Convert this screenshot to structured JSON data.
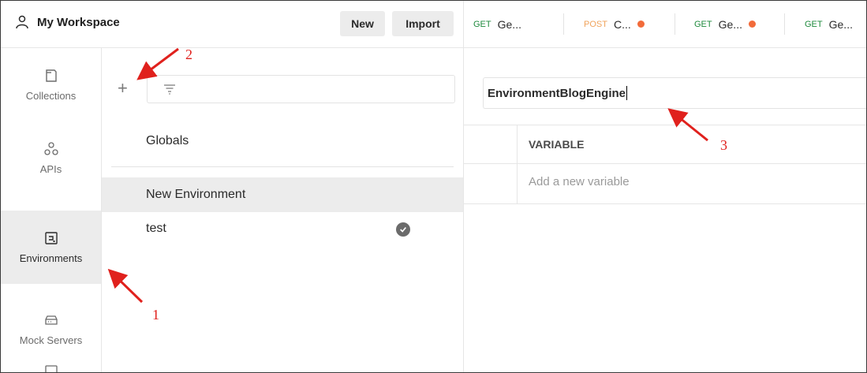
{
  "header": {
    "workspace_title": "My Workspace",
    "new_label": "New",
    "import_label": "Import"
  },
  "sidebar": {
    "items": [
      {
        "label": "Collections",
        "icon": "collections-icon"
      },
      {
        "label": "APIs",
        "icon": "apis-icon"
      },
      {
        "label": "Environments",
        "icon": "environments-icon",
        "active": true
      },
      {
        "label": "Mock Servers",
        "icon": "mock-servers-icon"
      }
    ]
  },
  "env_list": {
    "items": [
      {
        "label": "Globals"
      },
      {
        "label": "New Environment",
        "selected": true
      },
      {
        "label": "test",
        "active_check": true
      }
    ]
  },
  "tabs": [
    {
      "method": "GET",
      "title": "Ge...",
      "unsaved": false
    },
    {
      "method": "POST",
      "title": "C...",
      "unsaved": true
    },
    {
      "method": "GET",
      "title": "Ge...",
      "unsaved": true
    },
    {
      "method": "GET",
      "title": "Ge...",
      "unsaved": false
    }
  ],
  "editor": {
    "environment_name": "EnvironmentBlogEngine",
    "column_header": "VARIABLE",
    "add_placeholder": "Add a new variable"
  },
  "annotations": {
    "marker_1": "1",
    "marker_2": "2",
    "marker_3": "3"
  },
  "colors": {
    "annotation": "#e0211d",
    "get": "#1e8a3c",
    "post": "#f0a35b",
    "unsaved_dot": "#f26b3a"
  }
}
